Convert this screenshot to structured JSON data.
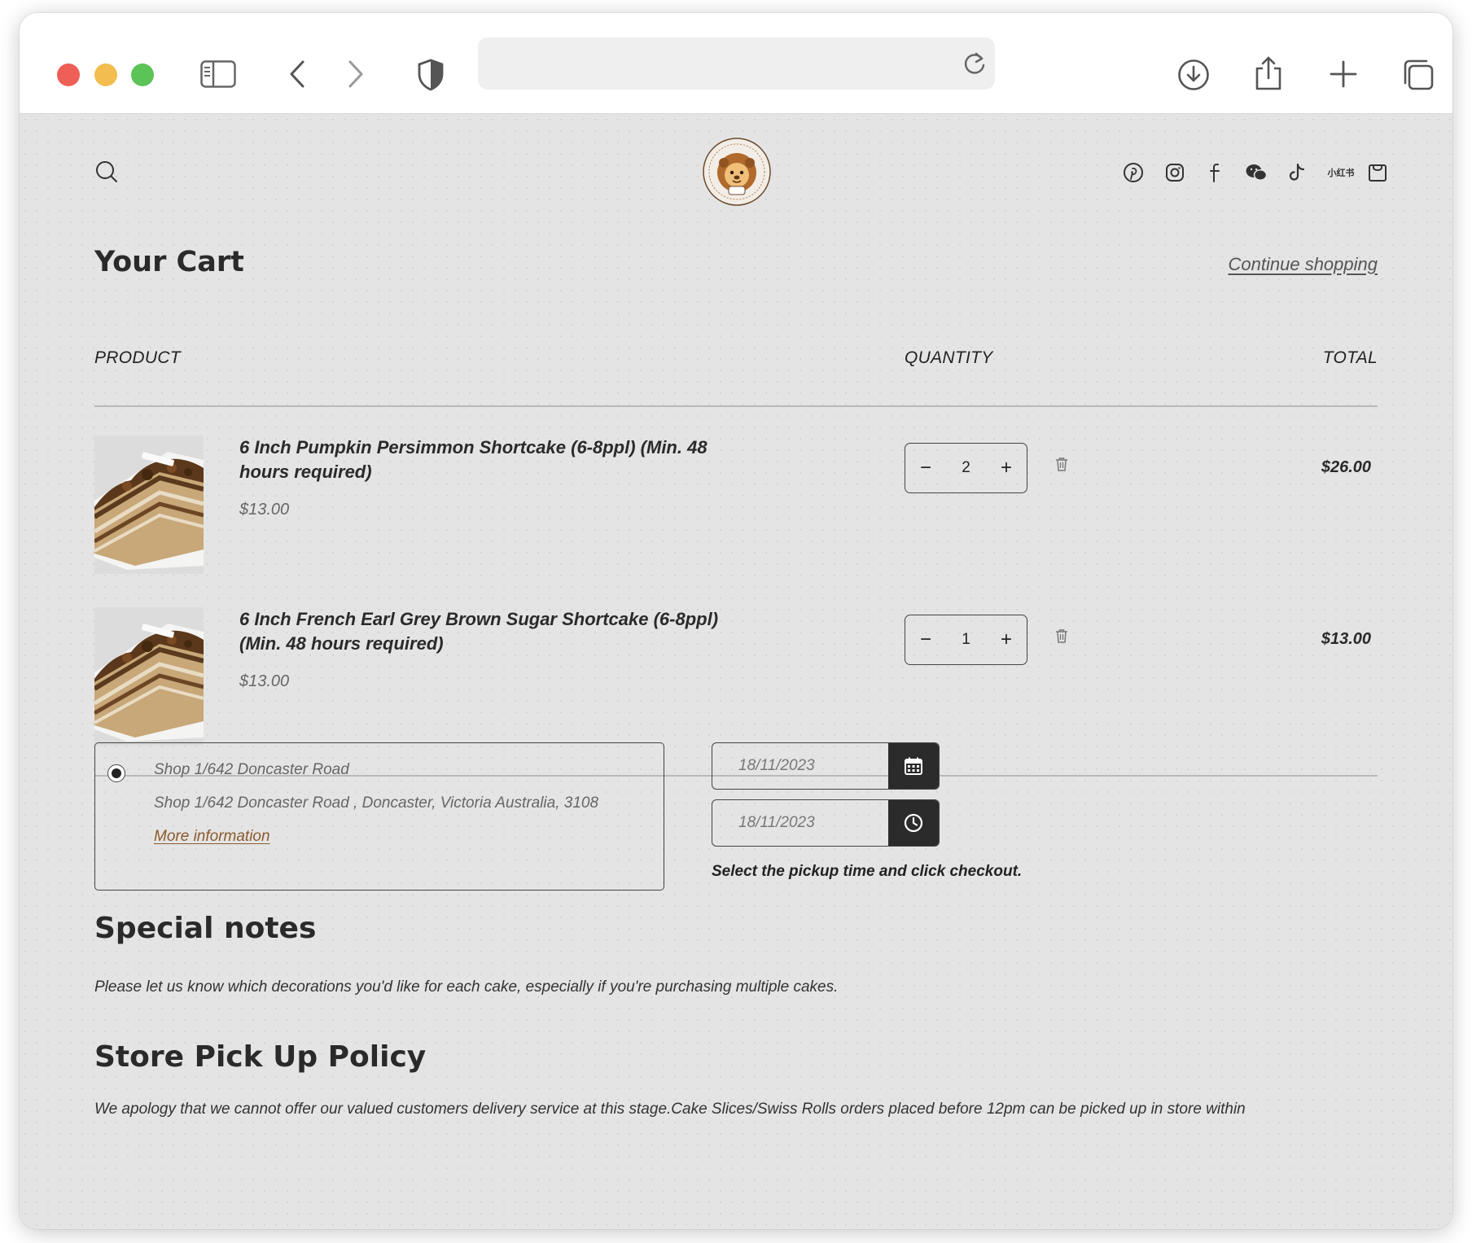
{
  "browser": {
    "url": "",
    "icons": [
      "sidebar-icon",
      "back-icon",
      "forward-icon",
      "shield-icon",
      "reload-icon",
      "download-icon",
      "share-icon",
      "new-tab-icon",
      "tabs-overview-icon"
    ]
  },
  "header": {
    "logo_alt": "LOVEY PATISSERIE CAFE",
    "social_icons": [
      "pinterest-icon",
      "instagram-icon",
      "facebook-icon",
      "wechat-icon",
      "tiktok-icon",
      "xiaohongshu-icon",
      "cart-icon"
    ],
    "xiaohongshu_text": "小红书"
  },
  "cart": {
    "title": "Your Cart",
    "continue_label": "Continue shopping",
    "columns": {
      "product": "PRODUCT",
      "quantity": "QUANTITY",
      "total": "TOTAL"
    },
    "items": [
      {
        "name": "6 Inch Pumpkin Persimmon Shortcake (6-8ppl) (Min. 48 hours required)",
        "price": "$13.00",
        "quantity": "2",
        "total": "$26.00"
      },
      {
        "name": "6 Inch French Earl Grey Brown Sugar Shortcake (6-8ppl) (Min. 48 hours required)",
        "price": "$13.00",
        "quantity": "1",
        "total": "$13.00"
      }
    ],
    "qty_minus": "−",
    "qty_plus": "+"
  },
  "pickup": {
    "store_name": "Shop 1/642 Doncaster Road",
    "store_address": "Shop 1/642 Doncaster Road , Doncaster, Victoria Australia, 3108",
    "more_info": "More information",
    "date_placeholder": "18/11/2023",
    "time_placeholder": "18/11/2023",
    "hint": "Select the pickup time and click checkout."
  },
  "notes": {
    "title": "Special notes",
    "text": "Please let us know which decorations you'd like for each cake, especially if you're purchasing multiple cakes."
  },
  "policy": {
    "title": "Store Pick Up Policy",
    "text": "We apology that we cannot offer our valued customers delivery service at this stage.Cake Slices/Swiss Rolls orders placed before 12pm can be picked up in store within"
  }
}
